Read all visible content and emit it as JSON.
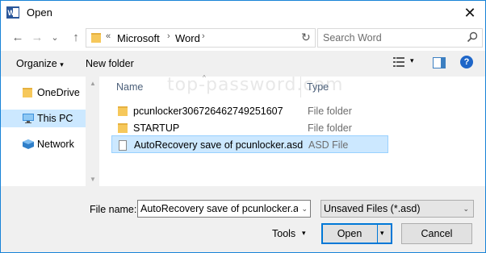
{
  "window": {
    "title": "Open",
    "app_icon": "word-icon",
    "close_glyph": "✕"
  },
  "navigation": {
    "back_glyph": "←",
    "forward_glyph": "→",
    "recent_glyph": "⌄",
    "up_glyph": "↑",
    "address": {
      "overflow": "«",
      "path": [
        "Microsoft",
        "Word"
      ],
      "separator": "›",
      "refresh_glyph": "↻"
    },
    "search": {
      "placeholder": "Search Word"
    }
  },
  "toolbar": {
    "organize_label": "Organize",
    "organize_caret": "▾",
    "new_folder_label": "New folder",
    "view_caret": "▾",
    "help_glyph": "?"
  },
  "sidebar": {
    "items": [
      {
        "label": "OneDrive",
        "icon": "onedrive-folder-icon",
        "selected": false
      },
      {
        "label": "This PC",
        "icon": "computer-icon",
        "selected": true
      },
      {
        "label": "Network",
        "icon": "network-icon",
        "selected": false
      }
    ]
  },
  "file_list": {
    "columns": [
      "Name",
      "Type"
    ],
    "sort_indicator": "^",
    "watermark": "top-password.com",
    "rows": [
      {
        "name": "pcunlocker306726462749251607",
        "type": "File folder",
        "icon": "folder-icon",
        "selected": false
      },
      {
        "name": "STARTUP",
        "type": "File folder",
        "icon": "folder-icon",
        "selected": false
      },
      {
        "name": "AutoRecovery save of pcunlocker.asd",
        "type": "ASD File",
        "icon": "document-icon",
        "selected": true
      }
    ]
  },
  "footer": {
    "file_name_label": "File name:",
    "file_name_value": "AutoRecovery save of pcunlocker.asd",
    "file_type_value": "Unsaved Files (*.asd)",
    "tools_label": "Tools",
    "tools_caret": "▾",
    "open_label": "Open",
    "open_split_caret": "▾",
    "cancel_label": "Cancel",
    "dropdown_caret": "⌄"
  },
  "colors": {
    "accent": "#0078d7",
    "selection_bg": "#cce8ff",
    "selection_border": "#99d1ff",
    "folder": "#f6c85b",
    "help": "#1e66c8"
  }
}
